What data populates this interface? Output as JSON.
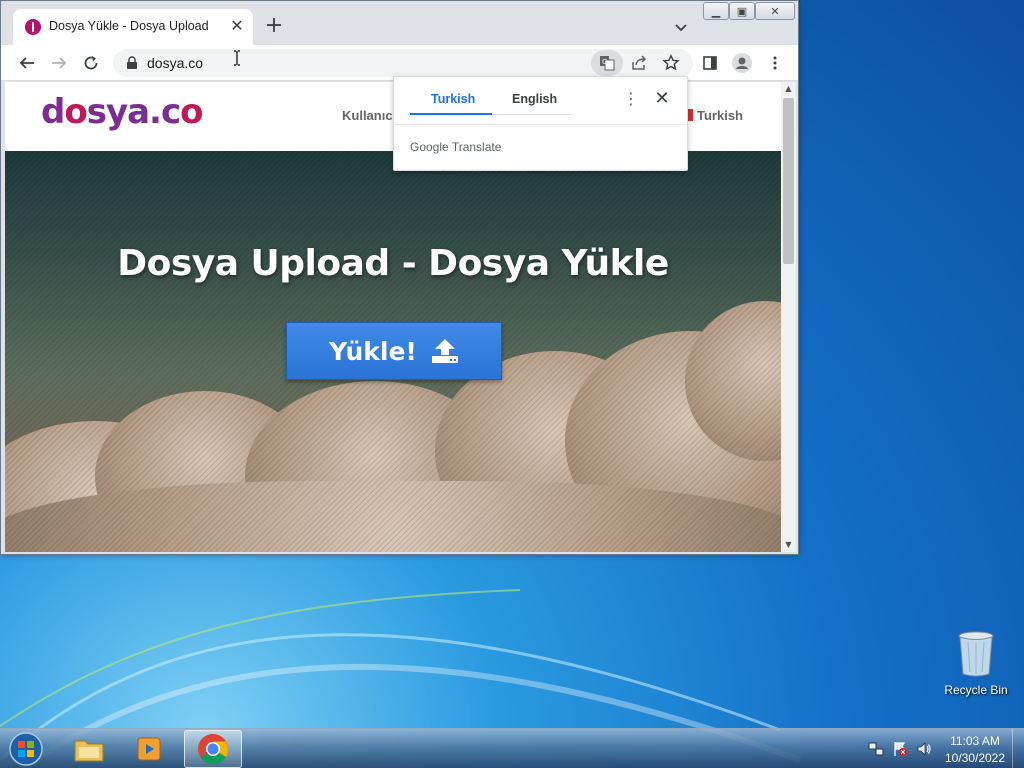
{
  "browser": {
    "tab": {
      "title": "Dosya Yükle - Dosya Upload",
      "favicon": "dosya-favicon"
    },
    "url": "dosya.co",
    "icons": [
      "back-icon",
      "forward-icon",
      "reload-icon",
      "lock-icon",
      "translate-icon",
      "share-icon",
      "bookmark-star-icon",
      "side-panel-icon",
      "profile-icon",
      "menu-icon"
    ]
  },
  "translate_popup": {
    "tabs": [
      {
        "label": "Turkish",
        "selected": true
      },
      {
        "label": "English",
        "selected": false
      }
    ],
    "brand": "Google Translate"
  },
  "site": {
    "logo": {
      "part1": "d",
      "o": "o",
      "part2": "sya.c",
      "o2": "o"
    },
    "nav_user": "Kullanıcı",
    "nav_lang": "Turkish",
    "hero_title": "Dosya Upload - Dosya Yükle",
    "upload_button": "Yükle!"
  },
  "desktop": {
    "recycle_bin": "Recycle Bin"
  },
  "taskbar": {
    "apps": [
      "file-explorer",
      "media-player",
      "chrome"
    ],
    "time": "11:03 AM",
    "date": "10/30/2022"
  },
  "colors": {
    "accent": "#1a73e8",
    "logo_purple": "#7b2d91",
    "logo_magenta": "#c2185b",
    "upload_button": "#2f7ddc"
  }
}
